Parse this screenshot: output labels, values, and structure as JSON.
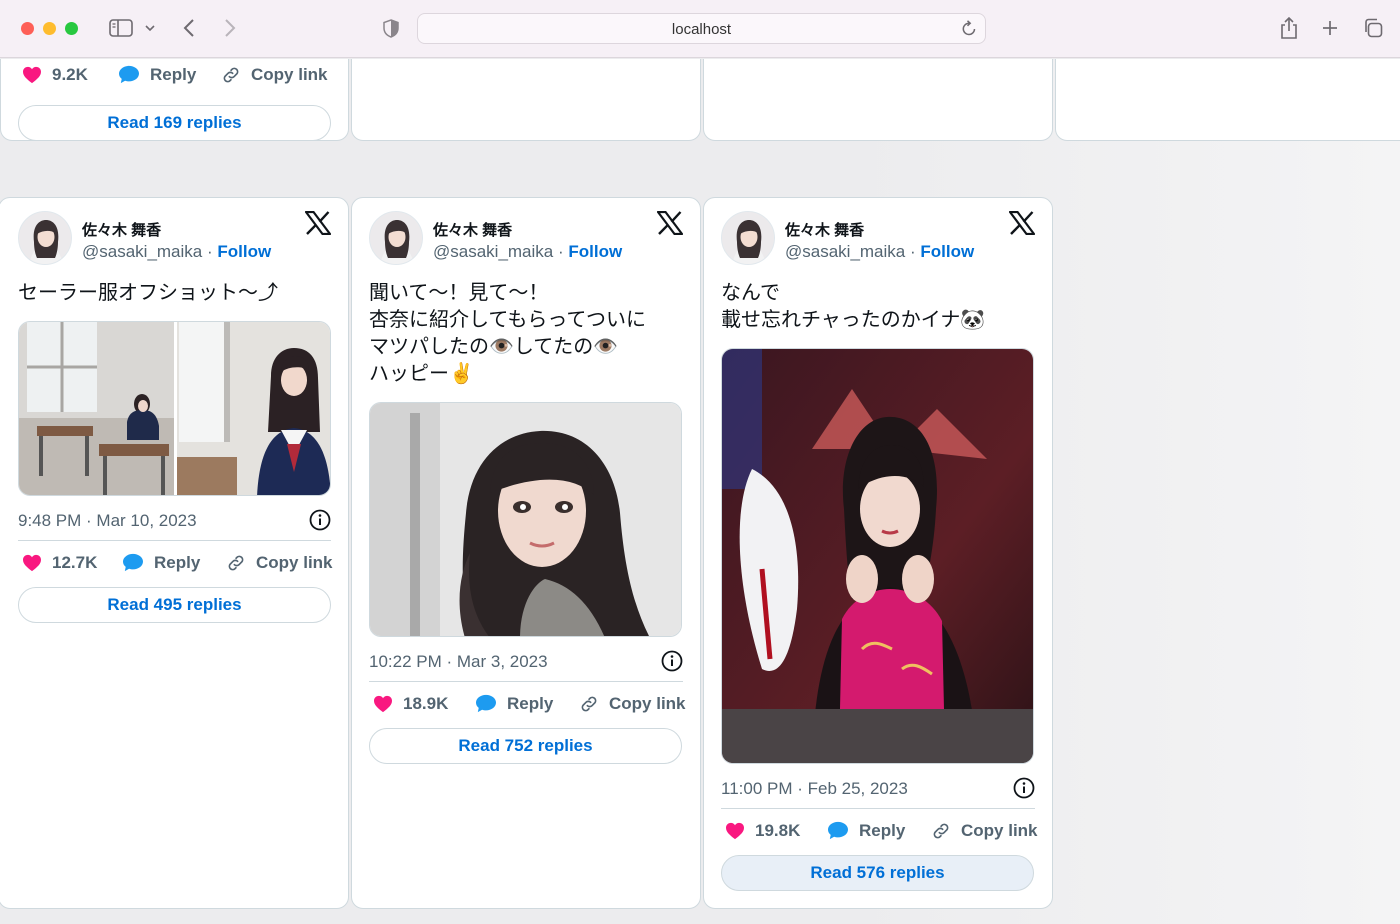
{
  "browser": {
    "url": "localhost"
  },
  "top_partial_card": {
    "likes": "9.2K",
    "reply_label": "Reply",
    "copy_label": "Copy link",
    "read_label": "Read 169 replies"
  },
  "tweets": [
    {
      "name": "佐々木 舞香",
      "handle": "@sasaki_maika",
      "dot": "·",
      "follow": "Follow",
      "text": "セーラー服オフショット〜⤴︎",
      "time": "9:48 PM · Mar 10, 2023",
      "likes": "12.7K",
      "reply_label": "Reply",
      "copy_label": "Copy link",
      "read_label": "Read 495 replies"
    },
    {
      "name": "佐々木 舞香",
      "handle": "@sasaki_maika",
      "dot": "·",
      "follow": "Follow",
      "text": "聞いて〜！見て〜！\n杏奈に紹介してもらってついに\nマツパしたの👁️してたの👁️\nハッピー✌️",
      "time": "10:22 PM · Mar 3, 2023",
      "likes": "18.9K",
      "reply_label": "Reply",
      "copy_label": "Copy link",
      "read_label": "Read 752 replies"
    },
    {
      "name": "佐々木 舞香",
      "handle": "@sasaki_maika",
      "dot": "·",
      "follow": "Follow",
      "text": "なんで\n載せ忘れチャったのかイナ🐼",
      "time": "11:00 PM · Feb 25, 2023",
      "likes": "19.8K",
      "reply_label": "Reply",
      "copy_label": "Copy link",
      "read_label": "Read 576 replies"
    }
  ],
  "colors": {
    "link": "#006fd6",
    "heart": "#f91880",
    "reply_bubble": "#1d9bf0",
    "muted": "#536471"
  }
}
